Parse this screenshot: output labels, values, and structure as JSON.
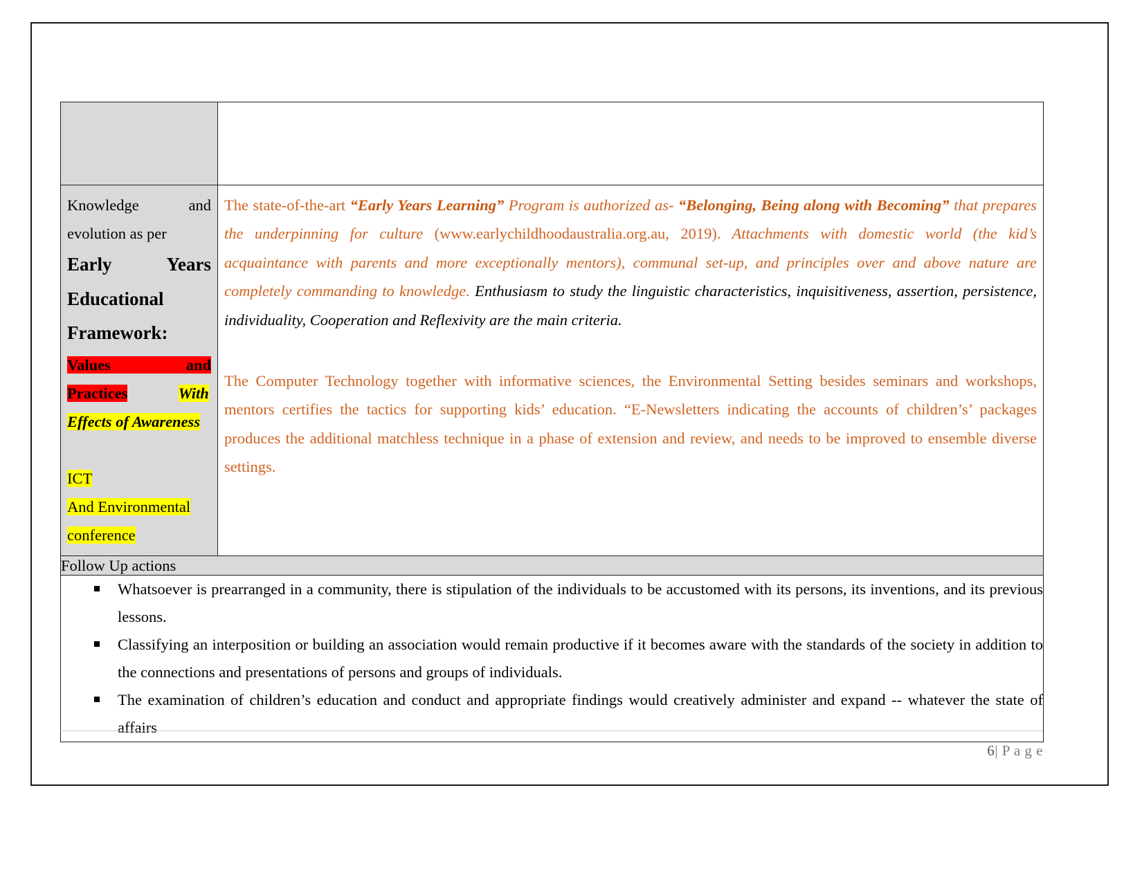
{
  "document": {
    "page_footer": {
      "page_number": "6",
      "separator": "|",
      "page_word": "P a g e"
    }
  },
  "table": {
    "spacer_row": {
      "label": "",
      "body": ""
    },
    "main_row": {
      "label": {
        "line1": "Knowledge                   and",
        "line2": "evolution as per",
        "heading1": "Early           Years",
        "heading2": "Educational",
        "heading3": "Framework:",
        "hl_values_and": "Values                    and",
        "hl_practices": "Practices",
        "hl_with": "With",
        "hl_effects": "Effects of Awareness",
        "hl_ict": "ICT",
        "hl_and_environmental": "And   Environmental",
        "hl_conference": "conference"
      },
      "body": {
        "para1": {
          "seg1": "The state-of-the-art ",
          "seg2": "“Early Years Learning”",
          "seg3": " Program is authorized as- ",
          "seg4": "“Belonging, Being along with Becoming”",
          "seg5": " that prepares the underpinning for culture ",
          "seg6": "(www.earlychildhoodaustralia.org.au, 2019).",
          "seg7": " Attachments with domestic world (the kid’s acquaintance with parents and more exceptionally mentors), communal set-up, and principles over and above nature are completely commanding to knowledge.",
          "seg8": " Enthusiasm to study the linguistic characteristics, inquisitiveness, assertion, persistence, individuality, Cooperation and Reflexivity are the main criteria."
        },
        "para2": {
          "text": "The Computer Technology together with informative sciences, the Environmental Setting besides seminars and workshops, mentors certifies the tactics for supporting kids’ education. “E-Newsletters indicating the accounts of children’s’ packages produces the additional matchless technique in a phase of extension and review, and needs to be improved to ensemble diverse settings."
        }
      }
    },
    "followup_row": {
      "title": "Follow Up actions"
    },
    "bullets_row": {
      "items": [
        "Whatsoever is prearranged in a community, there is stipulation of the individuals to be accustomed with its persons, its inventions, and its previous lessons.",
        " Classifying an interposition or building an association would remain productive if it becomes aware with the standards of the society in addition to the connections and presentations of persons and groups of individuals.",
        "The examination of children’s education and conduct and appropriate findings would creatively administer and expand -- whatever the state of affairs"
      ]
    }
  },
  "colors": {
    "orange_text": "#cf6322",
    "highlight_red": "#ff0000",
    "highlight_yellow": "#ffff00",
    "cell_shade": "#d9d9d9",
    "border": "#1f1f1f",
    "footer_text": "#7a7a7a"
  }
}
